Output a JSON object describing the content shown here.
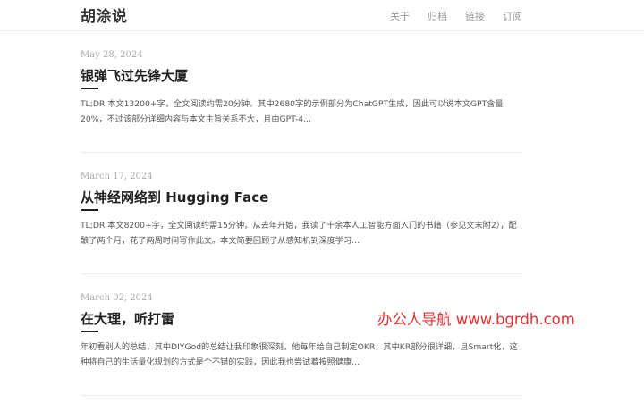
{
  "site": {
    "title": "胡涂说"
  },
  "nav": {
    "items": [
      {
        "label": "关于"
      },
      {
        "label": "归档"
      },
      {
        "label": "链接"
      },
      {
        "label": "订阅"
      }
    ]
  },
  "posts": [
    {
      "date": "May 28, 2024",
      "title": "银弹飞过先锋大厦",
      "excerpt": "TL;DR 本文13200+字，全文阅读约需20分钟。其中2680字的示例部分为ChatGPT生成，因此可以说本文GPT含量20%，不过该部分详细内容与本文主旨关系不大，且由GPT-4..."
    },
    {
      "date": "March 17, 2024",
      "title": "从神经网络到 Hugging Face",
      "excerpt": "TL;DR 本文8200+字，全文阅读约需15分钟。从去年开始，我读了十余本人工智能方面入门的书籍（参见文末附2），配酿了两个月，花了两周时间写作此文。本文简要回顾了从感知机到深度学习..."
    },
    {
      "date": "March 02, 2024",
      "title": "在大理，听打雷",
      "excerpt": "年初看别人的总结，其中DIYGod的总结让我印象很深刻，他每年给自己制定OKR，其中KR部分很详细，且Smart化，这种将自己的生活量化规划的方式是个不错的实践，因此我也尝试着按照健康..."
    }
  ],
  "watermark": {
    "text": "办公人导航  www.bgrdh.com",
    "color": "#e62f2f"
  }
}
